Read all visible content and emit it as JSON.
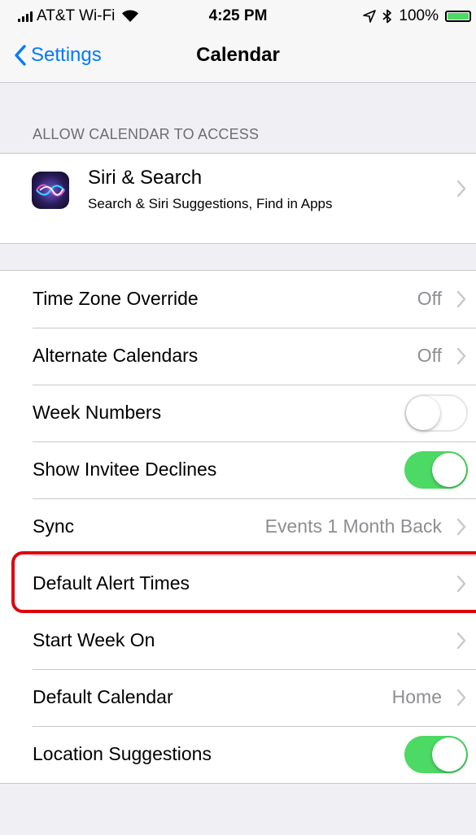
{
  "status_bar": {
    "carrier": "AT&T Wi-Fi",
    "time": "4:25 PM",
    "battery": "100%",
    "battery_level": 1.0
  },
  "nav": {
    "back_label": "Settings",
    "title": "Calendar"
  },
  "section_access": {
    "header": "ALLOW CALENDAR TO ACCESS",
    "siri": {
      "title": "Siri & Search",
      "subtitle": "Search & Siri Suggestions, Find in Apps",
      "icon": "siri-icon"
    }
  },
  "settings": {
    "time_zone": {
      "label": "Time Zone Override",
      "value": "Off"
    },
    "alternate": {
      "label": "Alternate Calendars",
      "value": "Off"
    },
    "week_numbers": {
      "label": "Week Numbers",
      "on": false
    },
    "invitee_declines": {
      "label": "Show Invitee Declines",
      "on": true
    },
    "sync": {
      "label": "Sync",
      "value": "Events 1 Month Back"
    },
    "default_alert": {
      "label": "Default Alert Times",
      "value": ""
    },
    "start_week": {
      "label": "Start Week On",
      "value": ""
    },
    "default_calendar": {
      "label": "Default Calendar",
      "value": "Home"
    },
    "location": {
      "label": "Location Suggestions",
      "on": true
    }
  },
  "colors": {
    "accent": "#007aff",
    "toggle_on": "#4cd964",
    "highlight": "#e0000b",
    "background": "#efeff4"
  }
}
